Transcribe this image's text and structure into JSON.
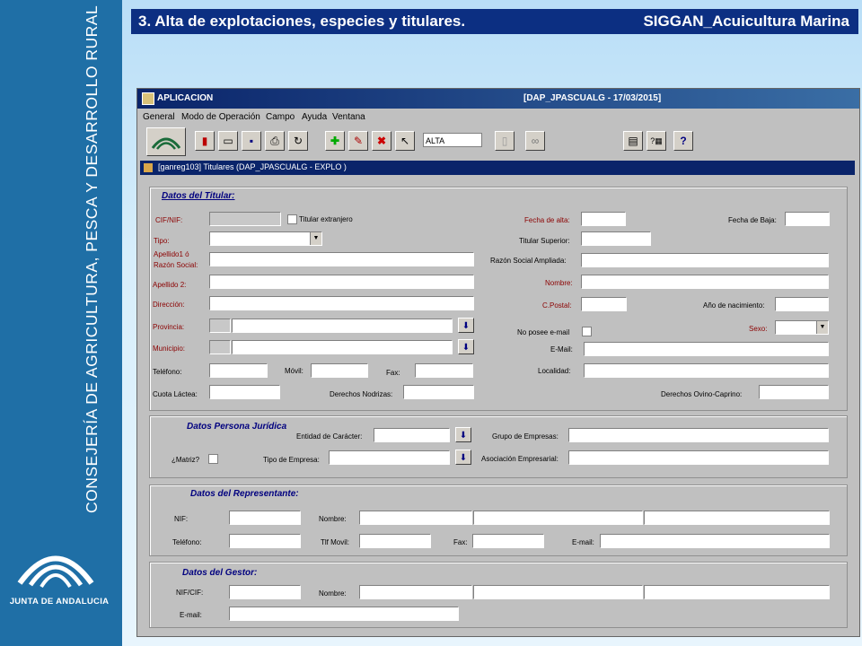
{
  "slide": {
    "header_left": "3. Alta de explotaciones, especies y titulares.",
    "header_right": "SIGGAN_Acuicultura Marina",
    "sidebar_text": "CONSEJERÍA DE AGRICULTURA, PESCA Y DESARROLLO RURAL",
    "logo_text": "JUNTA DE ANDALUCIA"
  },
  "app": {
    "title": "APLICACION",
    "session": "[DAP_JPASCUALG - 17/03/2015]",
    "menu": [
      "General",
      "Modo de Operación",
      "Campo",
      "Ayuda",
      "Ventana"
    ],
    "mode_field": "ALTA",
    "subwindow": "[ganreg103] Titulares (DAP_JPASCUALG - EXPLO )"
  },
  "titular": {
    "section": "Datos del Titular:",
    "cif": "CIF/NIF:",
    "extranjero": "Titular extranjero",
    "tipo": "Tipo:",
    "apellido1": "Apellido1 ó",
    "razon_social": "Razón Social:",
    "apellido2": "Apellido 2:",
    "direccion": "Dirección:",
    "provincia": "Provincia:",
    "municipio": "Municipio:",
    "telefono": "Teléfono:",
    "movil": "Móvil:",
    "fax": "Fax:",
    "cuota": "Cuota Láctea:",
    "nodrizas": "Derechos Nodrizas:",
    "fecha_alta": "Fecha de alta:",
    "fecha_baja": "Fecha de Baja:",
    "titular_superior": "Titular Superior:",
    "razon_ampliada": "Razón Social  Ampliada:",
    "nombre": "Nombre:",
    "cpostal": "C.Postal:",
    "anio_nac": "Año de nacimiento:",
    "no_email": "No posee e-mail",
    "sexo": "Sexo:",
    "email": "E-Mail:",
    "localidad": "Localidad:",
    "ovino": "Derechos Ovino-Caprino:"
  },
  "juridica": {
    "section": "Datos Persona Jurídica",
    "entidad": "Entidad de Carácter:",
    "grupo": "Grupo de Empresas:",
    "matriz": "¿Matriz?",
    "tipo_empresa": "Tipo de Empresa:",
    "asociacion": "Asociación Empresarial:"
  },
  "representante": {
    "section": "Datos del Representante:",
    "nif": "NIF:",
    "nombre": "Nombre:",
    "telefono": "Teléfono:",
    "movil": "Tlf Movil:",
    "fax": "Fax:",
    "email": "E-mail:"
  },
  "gestor": {
    "section": "Datos del  Gestor:",
    "nif": "NIF/CIF:",
    "nombre": "Nombre:",
    "email": "E-mail:"
  },
  "colors": {
    "sidebar": "#1f6fa6",
    "header": "#0c2f82",
    "label_red": "#8b0000"
  }
}
